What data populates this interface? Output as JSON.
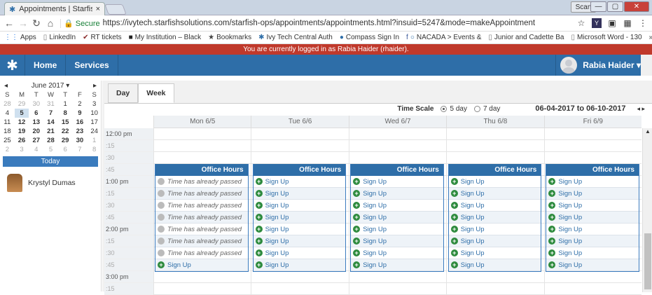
{
  "browser": {
    "tab_title": "Appointments | Starfish",
    "tab_close": "×",
    "user_chip": "Scan",
    "win_min": "—",
    "win_max": "▢",
    "win_close": "✕",
    "secure_label": "🔒 Secure",
    "url": "https://ivytech.starfishsolutions.com/starfish-ops/appointments/appointments.html?insuid=5247&mode=makeAppointment",
    "bookmarks": [
      "Apps",
      "LinkedIn",
      "RT tickets",
      "My Institution – Black",
      "Bookmarks",
      "Ivy Tech Central Auth",
      "Compass Sign In",
      "NACADA > Events &",
      "Junior and Cadette Ba",
      "Microsoft Word - 130"
    ],
    "bookmarks_more": "»"
  },
  "banner": "You are currently logged in as Rabia Haider (rhaider).",
  "appbar": {
    "logo": "✱",
    "menu": [
      "Home",
      "Services"
    ],
    "user_name": "Rabia Haider ▾"
  },
  "mini_calendar": {
    "month_label": "June 2017 ▾",
    "prev": "◂",
    "next": "▸",
    "weekdays": [
      "S",
      "M",
      "T",
      "W",
      "T",
      "F",
      "S"
    ],
    "weeks": [
      [
        "28",
        "29",
        "30",
        "31",
        "1",
        "2",
        "3"
      ],
      [
        "4",
        "5",
        "6",
        "7",
        "8",
        "9",
        "10"
      ],
      [
        "11",
        "12",
        "13",
        "14",
        "15",
        "16",
        "17"
      ],
      [
        "18",
        "19",
        "20",
        "21",
        "22",
        "23",
        "24"
      ],
      [
        "25",
        "26",
        "27",
        "28",
        "29",
        "30",
        "1"
      ],
      [
        "2",
        "3",
        "4",
        "5",
        "6",
        "7",
        "8"
      ]
    ],
    "today_label": "Today"
  },
  "person": "Krystyl Dumas",
  "view_tabs": [
    "Day",
    "Week"
  ],
  "timescale": {
    "label": "Time Scale",
    "opt1": "5 day",
    "opt2": "7 day",
    "date_range": "06-04-2017 to 06-10-2017",
    "arrows": "◂  ▸"
  },
  "days": [
    "Mon 6/5",
    "Tue 6/6",
    "Wed 6/7",
    "Thu 6/8",
    "Fri 6/9"
  ],
  "times": [
    "12:00 pm",
    ":15",
    ":30",
    ":45",
    "1:00 pm",
    ":15",
    ":30",
    ":45",
    "2:00 pm",
    ":15",
    ":30",
    ":45",
    "3:00 pm",
    ":15"
  ],
  "office_hours_label": "Office Hours",
  "slot_passed": "Time has already passed",
  "slot_signup": "Sign Up"
}
